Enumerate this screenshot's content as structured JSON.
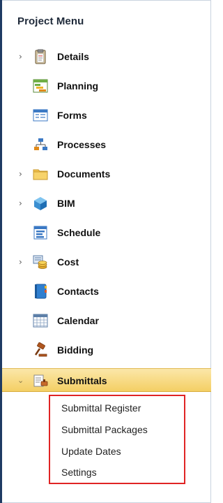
{
  "panel": {
    "title": "Project Menu"
  },
  "menu": {
    "items": [
      {
        "label": "Details",
        "icon": "clipboard-icon",
        "expandable": true
      },
      {
        "label": "Planning",
        "icon": "planning-icon",
        "expandable": false
      },
      {
        "label": "Forms",
        "icon": "forms-icon",
        "expandable": false
      },
      {
        "label": "Processes",
        "icon": "processes-icon",
        "expandable": false
      },
      {
        "label": "Documents",
        "icon": "folder-icon",
        "expandable": true
      },
      {
        "label": "BIM",
        "icon": "cube-icon",
        "expandable": true
      },
      {
        "label": "Schedule",
        "icon": "schedule-icon",
        "expandable": false
      },
      {
        "label": "Cost",
        "icon": "cost-icon",
        "expandable": true
      },
      {
        "label": "Contacts",
        "icon": "contacts-book-icon",
        "expandable": false
      },
      {
        "label": "Calendar",
        "icon": "calendar-icon",
        "expandable": false
      },
      {
        "label": "Bidding",
        "icon": "gavel-icon",
        "expandable": false
      },
      {
        "label": "Submittals",
        "icon": "submittals-icon",
        "expandable": true,
        "expanded": true,
        "selected": true
      }
    ]
  },
  "submittals": {
    "subitems": [
      {
        "label": "Submittal Register"
      },
      {
        "label": "Submittal Packages"
      },
      {
        "label": "Update Dates"
      },
      {
        "label": "Settings"
      }
    ]
  },
  "colors": {
    "accent_border": "#1f3b63",
    "selected_bg": "#f4cf64",
    "highlight_box": "#e02424"
  }
}
